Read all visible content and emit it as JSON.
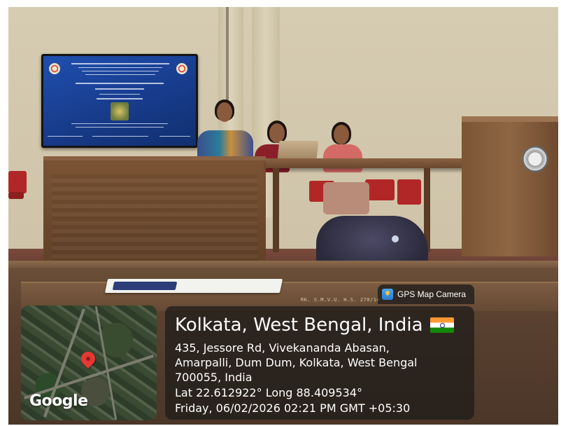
{
  "app": {
    "brand_label": "GPS Map Camera"
  },
  "photo": {
    "scene_icons": [
      "projected-slide",
      "wooden-desk",
      "wooden-table",
      "podium",
      "red-chairs",
      "bag",
      "papers"
    ],
    "stage_label": "RK. S.M.V.U. H.S. 270/14"
  },
  "map": {
    "logo_text": "Google"
  },
  "location": {
    "title": "Kolkata, West Bengal, India",
    "address_line1": "435, Jessore Rd, Vivekananda Abasan,",
    "address_line2": "Amarpalli, Dum Dum, Kolkata, West Bengal",
    "address_line3": "700055, India",
    "coords": "Lat 22.612922° Long 88.409534°",
    "datetime": "Friday, 06/02/2026 02:21 PM GMT +05:30"
  },
  "colors": {
    "overlay_bg": "#1e1c1a",
    "pin": "#e53935",
    "text": "#ffffff"
  }
}
